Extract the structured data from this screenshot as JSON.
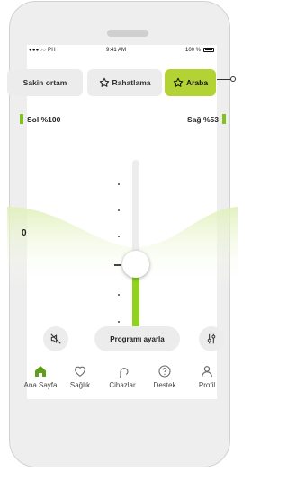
{
  "status_bar": {
    "carrier": "●●●○○ PH",
    "time": "9:41 AM",
    "battery": "100 %"
  },
  "tabs": [
    {
      "label": "Sakin ortam",
      "favorite": false,
      "active": false
    },
    {
      "label": "Rahatlama",
      "favorite": true,
      "active": false
    },
    {
      "label": "Araba",
      "favorite": true,
      "active": true
    }
  ],
  "hearing_aids": {
    "left": "Sol %100",
    "right": "Sağ %53"
  },
  "volume": {
    "value": "0"
  },
  "buttons": {
    "adjust_program": "Programı ayarla"
  },
  "icons": {
    "mute": "speaker-muted-icon",
    "adjust": "sliders-icon"
  },
  "nav": [
    {
      "label": "Ana Sayfa",
      "icon": "home-icon",
      "active": true
    },
    {
      "label": "Sağlık",
      "icon": "heart-icon",
      "active": false
    },
    {
      "label": "Cihazlar",
      "icon": "hearing-aid-icon",
      "active": false
    },
    {
      "label": "Destek",
      "icon": "help-icon",
      "active": false
    },
    {
      "label": "Profil",
      "icon": "profile-icon",
      "active": false
    }
  ],
  "colors": {
    "accent": "#b3d334",
    "slider_fill": "#90d21e",
    "battery_green": "#7fc31c",
    "home_icon": "#5fa01a"
  }
}
